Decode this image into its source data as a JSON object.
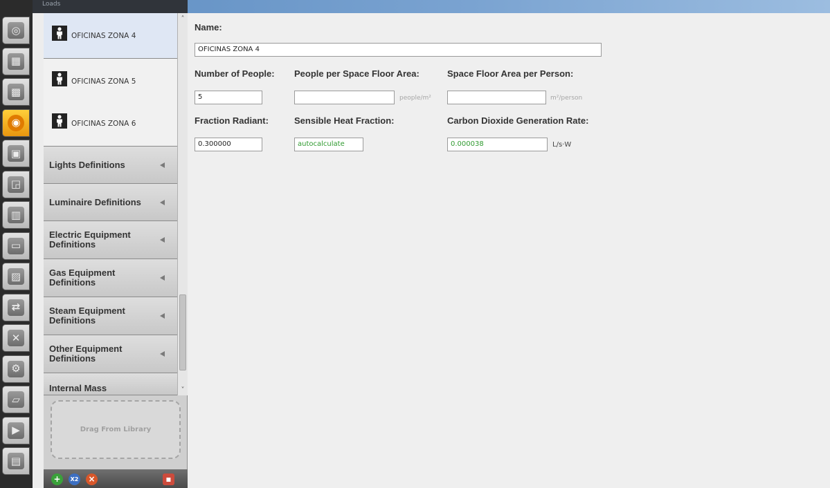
{
  "window": {
    "title": "Loads",
    "vertical_tabs": [
      {
        "name": "site-icon",
        "glyph": "◎"
      },
      {
        "name": "schedules-icon",
        "glyph": "▦"
      },
      {
        "name": "constructions-icon",
        "glyph": "▩"
      },
      {
        "name": "loads-icon",
        "glyph": "◉"
      },
      {
        "name": "space-types-icon",
        "glyph": "▣"
      },
      {
        "name": "geometry-icon",
        "glyph": "◲"
      },
      {
        "name": "facility-icon",
        "glyph": "▥"
      },
      {
        "name": "spaces-icon",
        "glyph": "▭"
      },
      {
        "name": "thermal-zones-icon",
        "glyph": "▨"
      },
      {
        "name": "hvac-systems-icon",
        "glyph": "⇄"
      },
      {
        "name": "variables-icon",
        "glyph": "✕"
      },
      {
        "name": "simulation-settings-icon",
        "glyph": "⚙"
      },
      {
        "name": "measures-icon",
        "glyph": "▱"
      },
      {
        "name": "run-simulation-icon",
        "glyph": "▶"
      },
      {
        "name": "results-icon",
        "glyph": "▤"
      }
    ]
  },
  "sidebar": {
    "items": [
      {
        "label": "OFICINAS ZONA 4"
      },
      {
        "label": "OFICINAS ZONA 5"
      },
      {
        "label": "OFICINAS ZONA 6"
      }
    ],
    "categories": [
      {
        "label": "Lights Definitions"
      },
      {
        "label": "Luminaire Definitions"
      },
      {
        "label": "Electric Equipment Definitions"
      },
      {
        "label": "Gas Equipment Definitions"
      },
      {
        "label": "Steam Equipment Definitions"
      },
      {
        "label": "Other Equipment Definitions"
      },
      {
        "label": "Internal Mass"
      }
    ],
    "drop_zone": "Drag From Library",
    "bottom_buttons": {
      "add": "+",
      "copy": "X2",
      "remove": "×",
      "purge": "▪"
    }
  },
  "form": {
    "name_label": "Name:",
    "name_value": "OFICINAS ZONA 4",
    "number_of_people_label": "Number of People:",
    "number_of_people_value": "5",
    "people_per_area_label": "People per Space Floor Area:",
    "people_per_area_value": "",
    "people_per_area_unit": "people/m²",
    "area_per_person_label": "Space Floor Area per Person:",
    "area_per_person_value": "",
    "area_per_person_unit": "m²/person",
    "fraction_radiant_label": "Fraction Radiant:",
    "fraction_radiant_value": "0.300000",
    "sensible_heat_label": "Sensible Heat Fraction:",
    "sensible_heat_value": "autocalculate",
    "co2_label": "Carbon Dioxide Generation Rate:",
    "co2_value": "0.000038",
    "co2_unit": "L/s·W"
  },
  "colors": {
    "accent_active_tab": "#f0a020",
    "selected_item": "#dfe7f4",
    "autocalc_text": "#2f9a2f",
    "title_bar": "#6f9bcc"
  }
}
